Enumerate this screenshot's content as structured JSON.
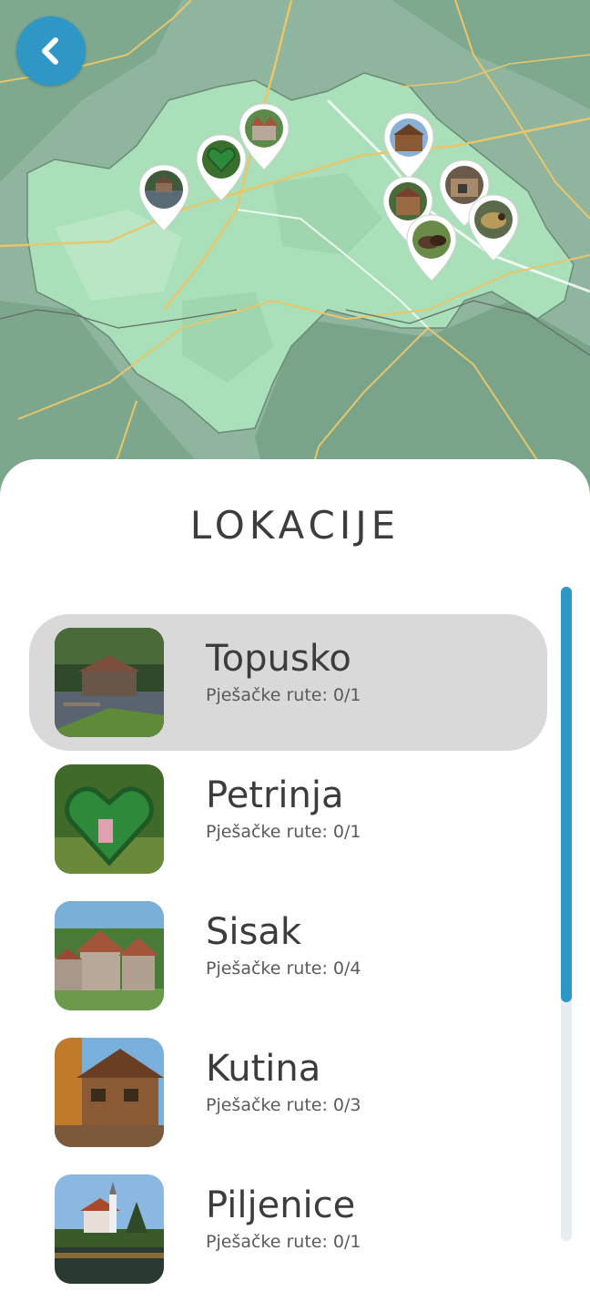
{
  "header": {
    "back_icon": "chevron-left-icon"
  },
  "map": {
    "colors": {
      "land": "#8fb8a0",
      "region": "#a8dfb8",
      "road": "#e9c66a",
      "accent": "#2f97c6"
    },
    "pins": [
      {
        "name": "pin-topusko",
        "icon": "mill-photo"
      },
      {
        "name": "pin-petrinja",
        "icon": "heart-sculpture-photo"
      },
      {
        "name": "pin-sisak",
        "icon": "castle-photo"
      },
      {
        "name": "pin-kutina",
        "icon": "wooden-house-photo"
      },
      {
        "name": "pin-5",
        "icon": "wooden-house-photo"
      },
      {
        "name": "pin-6",
        "icon": "cabin-photo"
      },
      {
        "name": "pin-7",
        "icon": "horses-photo"
      },
      {
        "name": "pin-8",
        "icon": "bird-photo"
      }
    ]
  },
  "locations": {
    "title": "LOKACIJE",
    "items": [
      {
        "name": "Topusko",
        "routes": "Pješačke rute: 0/1",
        "selected": true
      },
      {
        "name": "Petrinja",
        "routes": "Pješačke rute: 0/1",
        "selected": false
      },
      {
        "name": "Sisak",
        "routes": "Pješačke rute: 0/4",
        "selected": false
      },
      {
        "name": "Kutina",
        "routes": "Pješačke rute: 0/3",
        "selected": false
      },
      {
        "name": "Piljenice",
        "routes": "Pješačke rute: 0/1",
        "selected": false
      }
    ]
  },
  "scroll": {
    "position_fraction": 0.0,
    "visible_fraction": 0.64
  }
}
